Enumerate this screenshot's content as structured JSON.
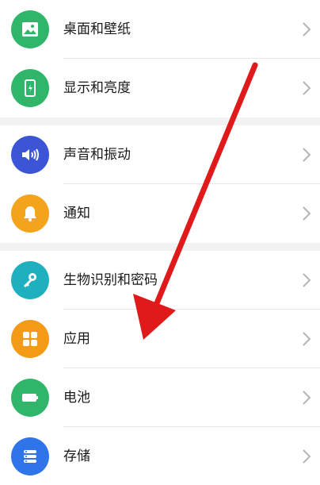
{
  "settings": {
    "items": [
      {
        "label": "桌面和壁纸",
        "icon": "image-icon",
        "color": "#2fb66a"
      },
      {
        "label": "显示和亮度",
        "icon": "phone-brightness-icon",
        "color": "#2fb66a"
      },
      {
        "label": "声音和振动",
        "icon": "speaker-icon",
        "color": "#3c55d6"
      },
      {
        "label": "通知",
        "icon": "bell-icon",
        "color": "#f4a31c"
      },
      {
        "label": "生物识别和密码",
        "icon": "key-icon",
        "color": "#1fb0bf"
      },
      {
        "label": "应用",
        "icon": "apps-grid-icon",
        "color": "#f39a16"
      },
      {
        "label": "电池",
        "icon": "battery-icon",
        "color": "#2fb66a"
      },
      {
        "label": "存储",
        "icon": "storage-icon",
        "color": "#2f74e8"
      }
    ]
  },
  "annotation": {
    "arrow_color": "#e01a1a"
  }
}
